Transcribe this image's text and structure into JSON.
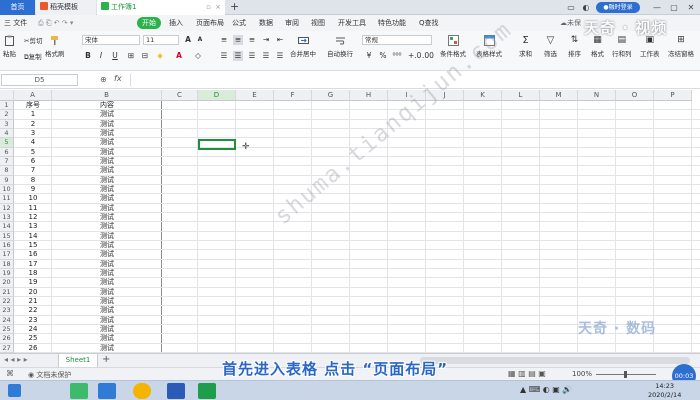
{
  "tabs": [
    {
      "label": "首页"
    },
    {
      "label": "稻壳模板"
    },
    {
      "label": "工作簿1"
    }
  ],
  "title_bar": {
    "new_tab": "+",
    "login": "●融时登录"
  },
  "menu": {
    "file": "三 文件",
    "items": [
      "开始",
      "插入",
      "页面布局",
      "公式",
      "数据",
      "审阅",
      "视图",
      "开发工具",
      "特色功能"
    ],
    "search": "Q查找",
    "right": "未保"
  },
  "ribbon": {
    "paste": "粘贴",
    "cut": "剪切",
    "copy": "复制",
    "format_painter": "格式刷",
    "font": "宋体",
    "size": "11",
    "number_format": "常规",
    "merge": "合并居中",
    "wrap": "自动换行",
    "cond_format": "条件格式",
    "table_style": "表格样式",
    "sum": "求和",
    "filter": "筛选",
    "sort": "排序",
    "format": "格式",
    "row_col": "行和列",
    "worksheet": "工作表",
    "freeze": "冻结窗格",
    "bold": "B",
    "italic": "I",
    "underline": "U"
  },
  "formula_bar": {
    "namebox": "D5",
    "fx": "fx"
  },
  "grid": {
    "columns": [
      "A",
      "B",
      "C",
      "D",
      "E",
      "F",
      "G",
      "H",
      "I",
      "J",
      "K",
      "L",
      "M",
      "N",
      "O",
      "P"
    ],
    "header_row": {
      "a": "序号",
      "b": "内容"
    },
    "rows": [
      {
        "n": "1",
        "a": "",
        "b": ""
      },
      {
        "n": "2",
        "a": "1",
        "b": "测试"
      },
      {
        "n": "3",
        "a": "2",
        "b": "测试"
      },
      {
        "n": "4",
        "a": "3",
        "b": "测试"
      },
      {
        "n": "5",
        "a": "4",
        "b": "测试"
      },
      {
        "n": "6",
        "a": "5",
        "b": "测试"
      },
      {
        "n": "7",
        "a": "6",
        "b": "测试"
      },
      {
        "n": "8",
        "a": "7",
        "b": "测试"
      },
      {
        "n": "9",
        "a": "8",
        "b": "测试"
      },
      {
        "n": "10",
        "a": "9",
        "b": "测试"
      },
      {
        "n": "11",
        "a": "10",
        "b": "测试"
      },
      {
        "n": "12",
        "a": "11",
        "b": "测试"
      },
      {
        "n": "13",
        "a": "12",
        "b": "测试"
      },
      {
        "n": "14",
        "a": "13",
        "b": "测试"
      },
      {
        "n": "15",
        "a": "14",
        "b": "测试"
      },
      {
        "n": "16",
        "a": "15",
        "b": "测试"
      },
      {
        "n": "17",
        "a": "16",
        "b": "测试"
      },
      {
        "n": "18",
        "a": "17",
        "b": "测试"
      },
      {
        "n": "19",
        "a": "18",
        "b": "测试"
      },
      {
        "n": "20",
        "a": "19",
        "b": "测试"
      },
      {
        "n": "21",
        "a": "20",
        "b": "测试"
      },
      {
        "n": "22",
        "a": "21",
        "b": "测试"
      },
      {
        "n": "23",
        "a": "22",
        "b": "测试"
      },
      {
        "n": "24",
        "a": "23",
        "b": "测试"
      },
      {
        "n": "25",
        "a": "24",
        "b": "测试"
      },
      {
        "n": "26",
        "a": "25",
        "b": "测试"
      },
      {
        "n": "27",
        "a": "26",
        "b": "测试"
      }
    ]
  },
  "watermark": "shuma.tianqijun.com",
  "sheet_tab": "Sheet1",
  "status": {
    "doc": "文档未保护",
    "zoom": "100%"
  },
  "caption": "首先进入表格 点击 “页面布局”",
  "brand": {
    "top": "天奇 · 视频",
    "bottom": "天奇 · 数码"
  },
  "taskbar": {
    "time": "14:23",
    "date": "2020/2/14"
  },
  "timer": "00:03",
  "colors": {
    "accent": "#2c6fd1",
    "green": "#2bb24c",
    "caption": "#2a66c9"
  }
}
